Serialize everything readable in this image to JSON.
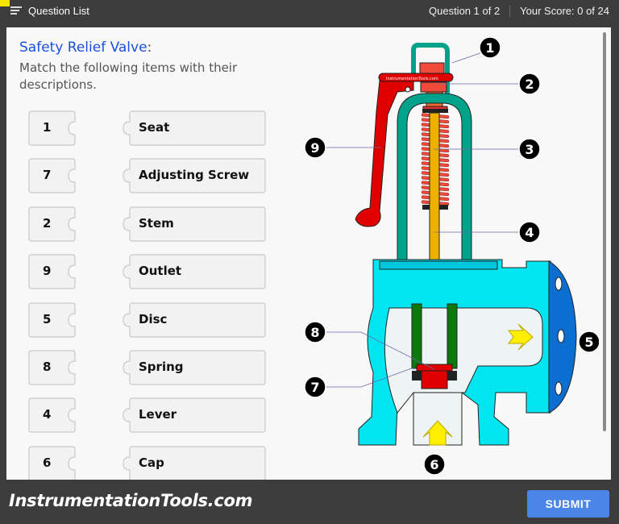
{
  "topbar": {
    "question_list_label": "Question List",
    "question_progress": "Question 1 of 2",
    "score": "Your Score: 0 of 24"
  },
  "question": {
    "title": "Safety Relief Valve",
    "title_suffix": ":",
    "instruction": "Match the following items with their descriptions."
  },
  "pairs": [
    {
      "number": "1",
      "label": "Seat"
    },
    {
      "number": "7",
      "label": "Adjusting Screw"
    },
    {
      "number": "2",
      "label": "Stem"
    },
    {
      "number": "9",
      "label": "Outlet"
    },
    {
      "number": "5",
      "label": "Disc"
    },
    {
      "number": "8",
      "label": "Spring"
    },
    {
      "number": "4",
      "label": "Lever"
    },
    {
      "number": "6",
      "label": "Cap"
    }
  ],
  "diagram": {
    "watermark": "InstrumentationTools.com",
    "callouts": [
      "1",
      "2",
      "3",
      "4",
      "5",
      "6",
      "7",
      "8",
      "9"
    ],
    "colors": {
      "body": "#00e5f0",
      "bonnet": "#00a38a",
      "flange": "#0a6fd0",
      "lever": "#e00000",
      "spring": "#f04a3a",
      "stem": "#f0b000",
      "guide": "#0a7a0a",
      "arrow": "#ffee00"
    }
  },
  "footer": {
    "brand": "InstrumentationTools.com",
    "submit_label": "SUBMIT"
  },
  "colors": {
    "accent": "#4a86e8",
    "title": "#1a4fe0",
    "topbar": "#3d3d3d"
  }
}
